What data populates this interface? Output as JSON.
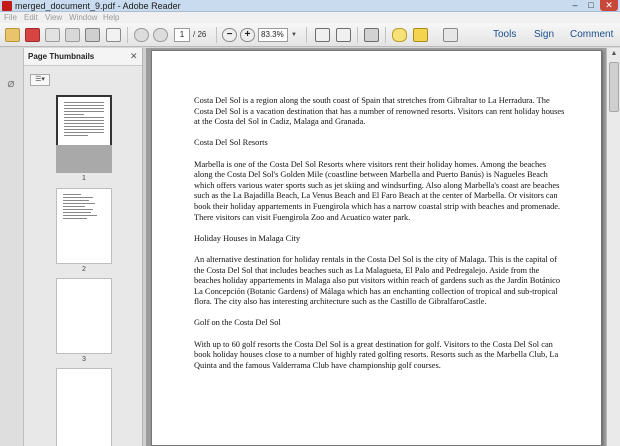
{
  "window": {
    "title": "merged_document_9.pdf - Adobe Reader",
    "controls": [
      "–",
      "□",
      "✕"
    ]
  },
  "menu": [
    "File",
    "Edit",
    "View",
    "Window",
    "Help"
  ],
  "toolbar": {
    "current_page": "1",
    "total_pages": "/ 26",
    "zoom": "83.3%",
    "zoom_out": "−",
    "zoom_in": "+",
    "links": [
      "Tools",
      "Sign",
      "Comment"
    ]
  },
  "sidebar": {
    "panel_title": "Page Thumbnails",
    "close": "✕",
    "thumbnails": [
      "1",
      "2",
      "3"
    ]
  },
  "document": {
    "paragraphs": [
      "Costa Del Sol is a region along the south coast of Spain that stretches from Gibraltar to La Herradura.  The Costa Del Sol is a vacation destination that has a number of renowned resorts. Visitors can rent holiday houses at the Costa del Sol in Cadiz, Malaga and Granada.",
      "Costa Del Sol Resorts",
      "Marbella is one of the Costa Del Sol Resorts where visitors rent their holiday homes. Among the beaches along the Costa Del Sol's Golden Mile (coastline between Marbella and Puerto Banús) is Nagueles Beach which offers various water sports such as jet skiing and windsurfing. Also along Marbella's coast are beaches such as the La Bajadilla Beach, La Venus Beach and El Faro Beach at the center of Marbella. Or visitors can book their holiday appartements in Fuengirola which has a narrow coastal strip with beaches and promenade. There visitors can visit Fuengirola Zoo and Acuatico water park.",
      "Holiday Houses in Malaga City",
      "An alternative destination for holiday rentals in the Costa Del Sol is the city of Malaga. This is the capital of the Costa Del Sol that includes beaches such as La Malagueta, El Palo and Pedregalejo. Aside from the beaches holiday appartements in Malaga also put visitors within reach of gardens such as the Jardín Botánico La Concepción (Botanic Gardens) of Málaga which has an enchanting collection of tropical and sub-tropical flora. The city also has interesting architecture such as the Castillo de GibralfaroCastle.",
      "Golf on the Costa Del Sol",
      "With up to 60 golf resorts the Costa Del Sol is a great destination for golf. Visitors to the Costa Del Sol can book holiday houses close to a number of highly rated golfing resorts. Resorts such as the Marbella Club, La Quinta and the famous Valderrama Club have championship golf courses."
    ]
  },
  "colors": {
    "accent_link": "#1e4f8c",
    "close_button": "#c7473a",
    "app_icon": "#c41a1a"
  },
  "icons": [
    "open-icon",
    "create-pdf-icon",
    "edit-icon",
    "save-icon",
    "print-icon",
    "email-icon",
    "prev-page-icon",
    "next-page-icon",
    "zoom-out-icon",
    "zoom-in-icon",
    "fit-page-icon",
    "full-screen-icon",
    "snapshot-icon",
    "sticky-note-icon",
    "highlight-icon",
    "sign-icon",
    "attachment-icon"
  ]
}
